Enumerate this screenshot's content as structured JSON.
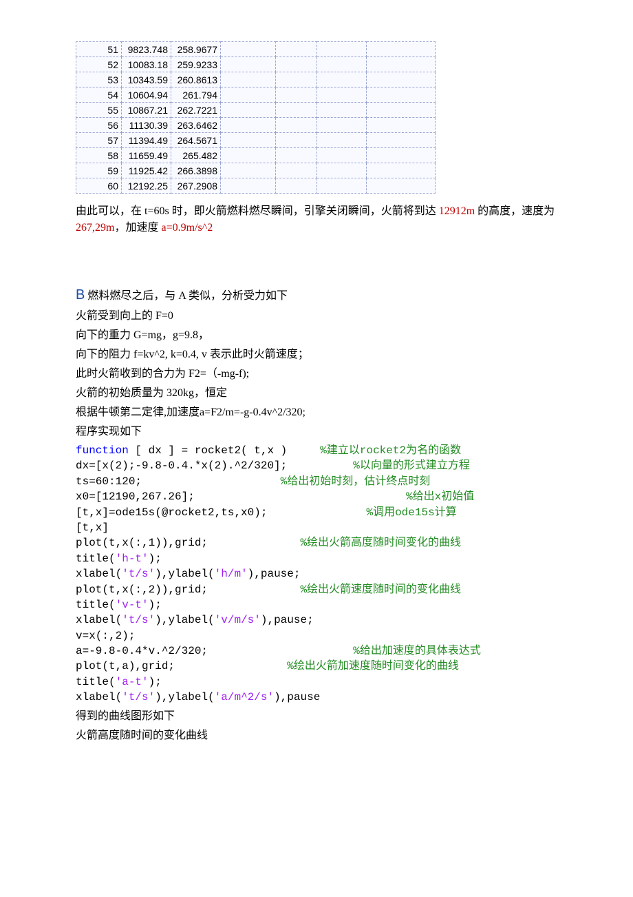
{
  "table": {
    "rows": [
      {
        "c0": "51",
        "c1": "9823.748",
        "c2": "258.9677"
      },
      {
        "c0": "52",
        "c1": "10083.18",
        "c2": "259.9233"
      },
      {
        "c0": "53",
        "c1": "10343.59",
        "c2": "260.8613"
      },
      {
        "c0": "54",
        "c1": "10604.94",
        "c2": "261.794"
      },
      {
        "c0": "55",
        "c1": "10867.21",
        "c2": "262.7221"
      },
      {
        "c0": "56",
        "c1": "11130.39",
        "c2": "263.6462"
      },
      {
        "c0": "57",
        "c1": "11394.49",
        "c2": "264.5671"
      },
      {
        "c0": "58",
        "c1": "11659.49",
        "c2": "265.482"
      },
      {
        "c0": "59",
        "c1": "11925.42",
        "c2": "266.3898"
      },
      {
        "c0": "60",
        "c1": "12192.25",
        "c2": "267.2908"
      }
    ]
  },
  "para1": {
    "pre": "由此可以，在 t=60s 时，即火箭燃料燃尽瞬间，引擎关闭瞬间，火箭将到达 ",
    "red1": "12912m",
    "mid1": " 的高度，速度为 ",
    "red2": "267,29m",
    "mid2": "，加速度 ",
    "red3": "a=0.9m/s^2"
  },
  "sectionB": {
    "label": "B",
    "title": " 燃料燃尽之后，与 A 类似，分析受力如下",
    "lines": [
      "火箭受到向上的 F=0",
      "向下的重力 G=mg，g=9.8，",
      "向下的阻力 f=kv^2,     k=0.4,     v 表示此时火箭速度；",
      "此时火箭收到的合力为 F2=（-mg-f);",
      "火箭的初始质量为 320kg，恒定",
      "根据牛顿第二定律,加速度a=F2/m=-g-0.4v^2/320;",
      "程序实现如下"
    ]
  },
  "code": [
    {
      "segments": [
        {
          "t": "function",
          "cls": "kw"
        },
        {
          "t": " [ dx ] = rocket2( t,x )     "
        },
        {
          "t": "%建立以rocket2为名的函数",
          "cls": "cmt"
        }
      ]
    },
    {
      "segments": [
        {
          "t": "dx=[x(2);-9.8-0.4.*x(2).^2/320];          "
        },
        {
          "t": "%以向量的形式建立方程",
          "cls": "cmt"
        }
      ]
    },
    {
      "segments": [
        {
          "t": "ts=60:120;                     "
        },
        {
          "t": "%给出初始时刻，估计终点时刻",
          "cls": "cmt"
        }
      ]
    },
    {
      "segments": [
        {
          "t": "x0=[12190,267.26];                                "
        },
        {
          "t": "%给出x初始值",
          "cls": "cmt"
        }
      ]
    },
    {
      "segments": [
        {
          "t": "[t,x]=ode15s(@rocket2,ts,x0);               "
        },
        {
          "t": "%调用ode15s计算",
          "cls": "cmt"
        }
      ]
    },
    {
      "segments": [
        {
          "t": "[t,x]"
        }
      ]
    },
    {
      "segments": [
        {
          "t": "plot(t,x(:,1)),grid;              "
        },
        {
          "t": "%绘出火箭高度随时间变化的曲线",
          "cls": "cmt"
        }
      ]
    },
    {
      "segments": [
        {
          "t": "title("
        },
        {
          "t": "'h-t'",
          "cls": "str"
        },
        {
          "t": ");"
        }
      ]
    },
    {
      "segments": [
        {
          "t": "xlabel("
        },
        {
          "t": "'t/s'",
          "cls": "str"
        },
        {
          "t": "),ylabel("
        },
        {
          "t": "'h/m'",
          "cls": "str"
        },
        {
          "t": "),pause;"
        }
      ]
    },
    {
      "segments": [
        {
          "t": "plot(t,x(:,2)),grid;              "
        },
        {
          "t": "%绘出火箭速度随时间的变化曲线",
          "cls": "cmt"
        }
      ]
    },
    {
      "segments": [
        {
          "t": "title("
        },
        {
          "t": "'v-t'",
          "cls": "str"
        },
        {
          "t": ");"
        }
      ]
    },
    {
      "segments": [
        {
          "t": "xlabel("
        },
        {
          "t": "'t/s'",
          "cls": "str"
        },
        {
          "t": "),ylabel("
        },
        {
          "t": "'v/m/s'",
          "cls": "str"
        },
        {
          "t": "),pause;"
        }
      ]
    },
    {
      "segments": [
        {
          "t": "v=x(:,2);"
        }
      ]
    },
    {
      "segments": [
        {
          "t": "a=-9.8-0.4*v.^2/320;                      "
        },
        {
          "t": "%给出加速度的具体表达式",
          "cls": "cmt"
        }
      ]
    },
    {
      "segments": [
        {
          "t": "plot(t,a),grid;                 "
        },
        {
          "t": "%绘出火箭加速度随时间变化的曲线",
          "cls": "cmt"
        }
      ]
    },
    {
      "segments": [
        {
          "t": "title("
        },
        {
          "t": "'a-t'",
          "cls": "str"
        },
        {
          "t": ");"
        }
      ]
    },
    {
      "segments": [
        {
          "t": "xlabel("
        },
        {
          "t": "'t/s'",
          "cls": "str"
        },
        {
          "t": "),ylabel("
        },
        {
          "t": "'a/m^2/s'",
          "cls": "str"
        },
        {
          "t": "),pause"
        }
      ]
    }
  ],
  "tail": [
    "得到的曲线图形如下",
    "火箭高度随时间的变化曲线"
  ]
}
